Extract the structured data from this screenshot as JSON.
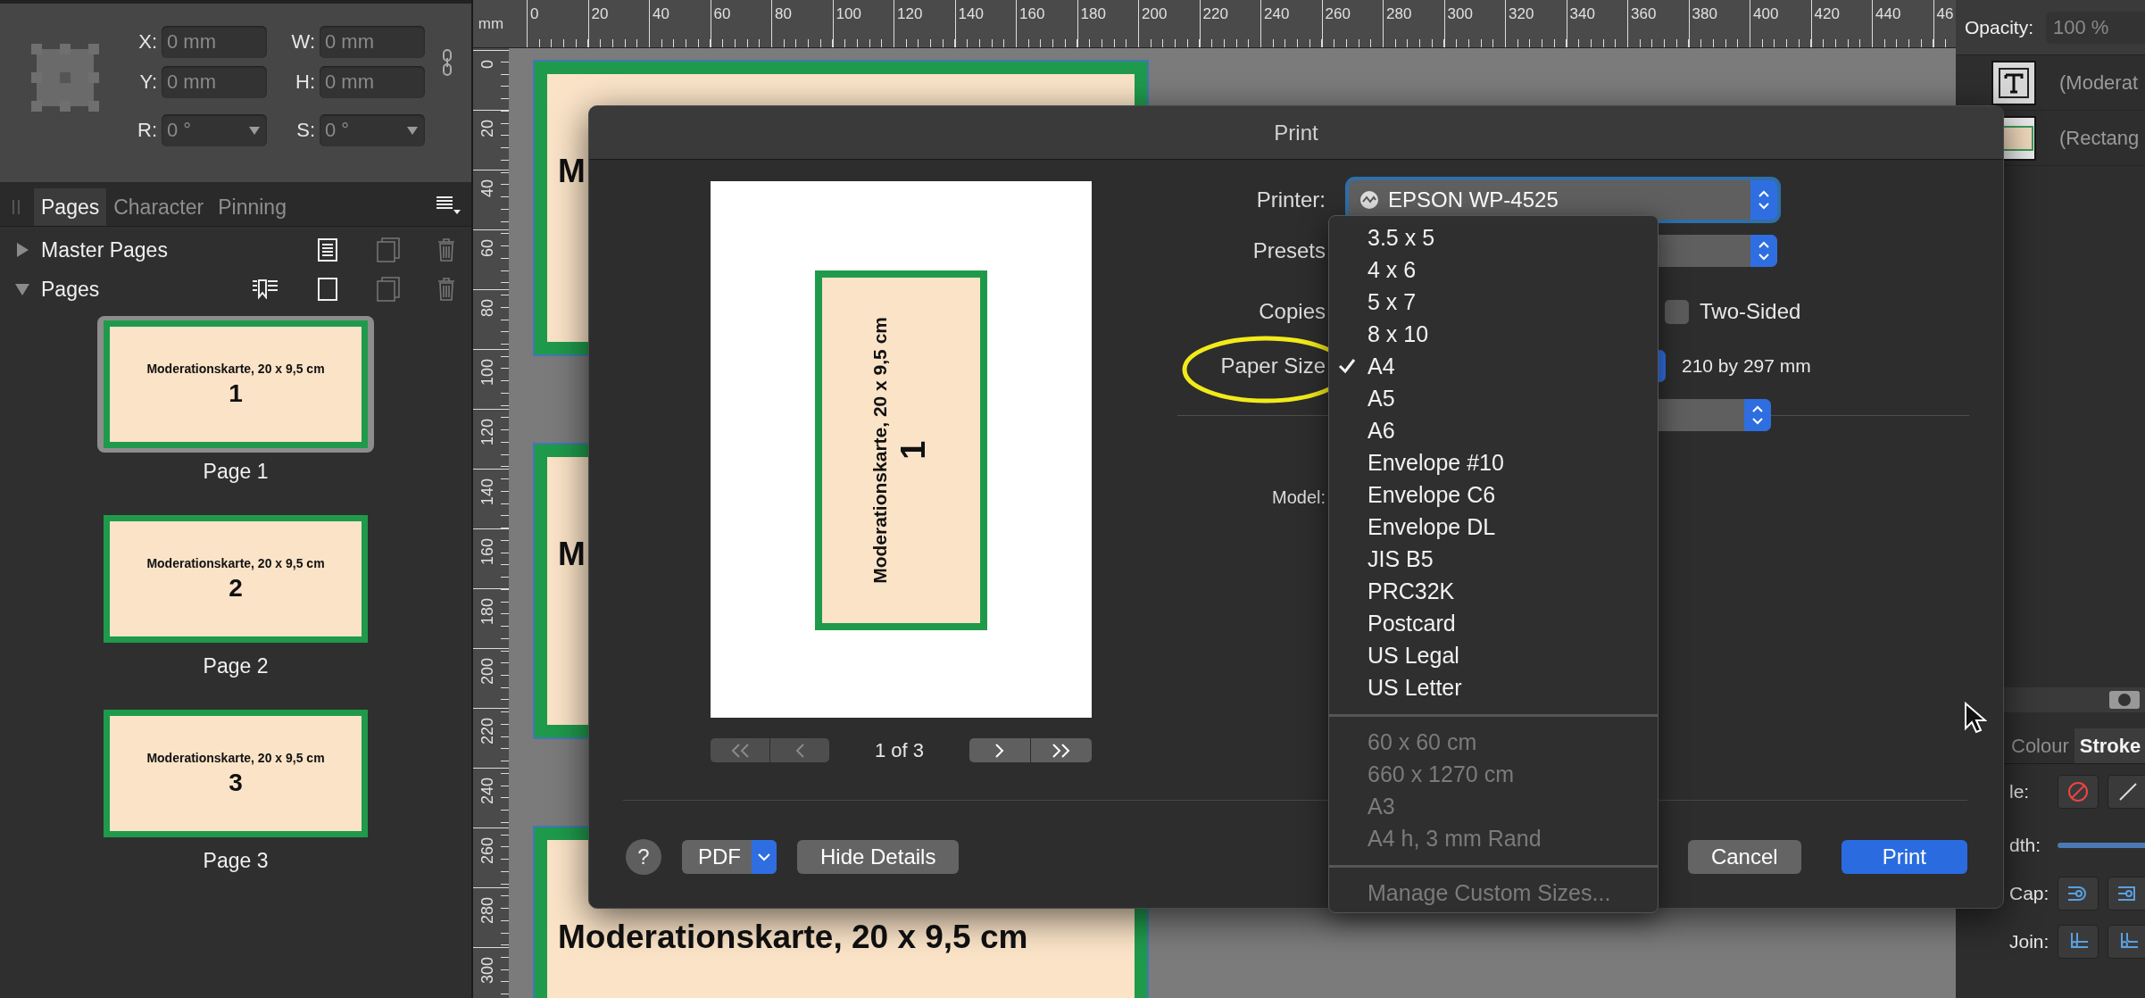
{
  "left_panel": {
    "transform": {
      "fields": [
        {
          "label": "X:",
          "value": "0 mm",
          "kind": "text"
        },
        {
          "label": "W:",
          "value": "0 mm",
          "kind": "text"
        },
        {
          "label": "Y:",
          "value": "0 mm",
          "kind": "text"
        },
        {
          "label": "H:",
          "value": "0 mm",
          "kind": "text"
        },
        {
          "label": "R:",
          "value": "0 °",
          "kind": "dropdown"
        },
        {
          "label": "S:",
          "value": "0 °",
          "kind": "dropdown"
        }
      ]
    },
    "tabs": [
      {
        "label": "Pages",
        "selected": true
      },
      {
        "label": "Character",
        "selected": false
      },
      {
        "label": "Pinning",
        "selected": false
      }
    ],
    "sections": [
      {
        "label": "Master Pages",
        "expanded": false,
        "kind": "master"
      },
      {
        "label": "Pages",
        "expanded": true,
        "kind": "pages"
      }
    ],
    "pages": [
      {
        "title": "Moderationskarte, 20 x 9,5 cm",
        "number": "1",
        "label": "Page 1",
        "selected": true
      },
      {
        "title": "Moderationskarte, 20 x 9,5 cm",
        "number": "2",
        "label": "Page 2",
        "selected": false
      },
      {
        "title": "Moderationskarte, 20 x 9,5 cm",
        "number": "3",
        "label": "Page 3",
        "selected": false
      }
    ]
  },
  "rulers": {
    "unit": "mm",
    "horizontal": [
      "0",
      "20",
      "40",
      "60",
      "80",
      "100",
      "120",
      "140",
      "160",
      "180",
      "200",
      "220",
      "240",
      "260",
      "280",
      "300",
      "320",
      "340",
      "360",
      "380",
      "400",
      "420",
      "440",
      "46"
    ],
    "vertical": [
      "0",
      "20",
      "40",
      "60",
      "80",
      "100",
      "120",
      "140",
      "160",
      "180",
      "200",
      "220",
      "240",
      "260",
      "280",
      "300"
    ]
  },
  "canvas": {
    "cards": [
      {
        "title": "M"
      },
      {
        "title": "M"
      },
      {
        "title": "Moderationskarte, 20 x 9,5 cm"
      }
    ]
  },
  "right_panel": {
    "opacity": {
      "label": "Opacity:",
      "value": "100 %"
    },
    "layers": [
      {
        "kind": "text",
        "name": "(Moderat"
      },
      {
        "kind": "rectangle",
        "name": "(Rectang"
      }
    ],
    "tabs": [
      {
        "label": "Colour",
        "selected": false
      },
      {
        "label": "Stroke",
        "selected": true
      }
    ],
    "rows": [
      {
        "kind": "style",
        "label": "le:"
      },
      {
        "kind": "width",
        "label": "dth:"
      },
      {
        "kind": "cap",
        "label": "Cap:"
      },
      {
        "kind": "join",
        "label": "Join:"
      }
    ]
  },
  "dialog": {
    "title": "Print",
    "preview": {
      "card_title": "Moderationskarte, 20 x 9,5 cm",
      "card_number": "1",
      "page_indicator": "1 of 3"
    },
    "form": {
      "printer": {
        "label": "Printer:",
        "value": "EPSON WP-4525"
      },
      "presets": {
        "label": "Presets"
      },
      "copies": {
        "label": "Copies",
        "two_sided": {
          "label": "Two-Sided",
          "checked": false
        }
      },
      "paper_size": {
        "label": "Paper Size",
        "dimensions": "210 by 297 mm"
      },
      "model": {
        "label": "Model:"
      }
    },
    "buttons": {
      "help": "?",
      "pdf": "PDF",
      "hide_details": "Hide Details",
      "cancel": "Cancel",
      "print": "Print"
    }
  },
  "paper_menu": {
    "sections": [
      {
        "items": [
          {
            "label": "3.5 x 5",
            "checked": false,
            "disabled": false
          },
          {
            "label": "4 x 6",
            "checked": false,
            "disabled": false
          },
          {
            "label": "5 x 7",
            "checked": false,
            "disabled": false
          },
          {
            "label": "8 x 10",
            "checked": false,
            "disabled": false
          },
          {
            "label": "A4",
            "checked": true,
            "disabled": false
          },
          {
            "label": "A5",
            "checked": false,
            "disabled": false
          },
          {
            "label": "A6",
            "checked": false,
            "disabled": false
          },
          {
            "label": "Envelope #10",
            "checked": false,
            "disabled": false
          },
          {
            "label": "Envelope C6",
            "checked": false,
            "disabled": false
          },
          {
            "label": "Envelope DL",
            "checked": false,
            "disabled": false
          },
          {
            "label": "JIS B5",
            "checked": false,
            "disabled": false
          },
          {
            "label": "PRC32K",
            "checked": false,
            "disabled": false
          },
          {
            "label": "Postcard",
            "checked": false,
            "disabled": false
          },
          {
            "label": "US Legal",
            "checked": false,
            "disabled": false
          },
          {
            "label": "US Letter",
            "checked": false,
            "disabled": false
          }
        ]
      },
      {
        "items": [
          {
            "label": "60 x 60 cm",
            "checked": false,
            "disabled": true
          },
          {
            "label": "660 x 1270 cm",
            "checked": false,
            "disabled": true
          },
          {
            "label": "A3",
            "checked": false,
            "disabled": true
          },
          {
            "label": "A4 h, 3 mm Rand",
            "checked": false,
            "disabled": true
          }
        ]
      },
      {
        "items": [
          {
            "label": "Manage Custom Sizes...",
            "checked": false,
            "disabled": true
          }
        ]
      }
    ]
  }
}
